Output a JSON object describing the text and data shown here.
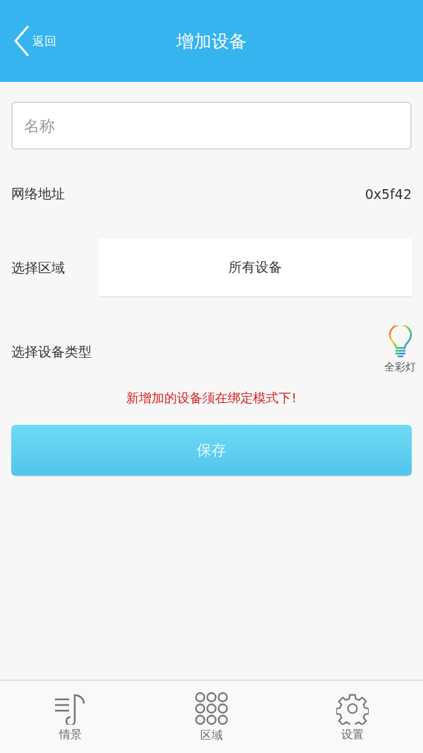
{
  "header": {
    "back_label": "返回",
    "title": "增加设备"
  },
  "name_field": {
    "placeholder": "名称"
  },
  "network_address": {
    "label": "网络地址",
    "value": "0x5f42"
  },
  "area": {
    "label": "选择区域",
    "value": "所有设备"
  },
  "device_type": {
    "label": "选择设备类型",
    "type_name": "全彩灯"
  },
  "warning": "新增加的设备须在绑定模式下!",
  "save_button": "保存",
  "tabs": [
    {
      "label": "情景",
      "kind": "scene",
      "selected": false
    },
    {
      "label": "区域",
      "kind": "area",
      "selected": false
    },
    {
      "label": "设置",
      "kind": "settings",
      "selected": false
    }
  ]
}
